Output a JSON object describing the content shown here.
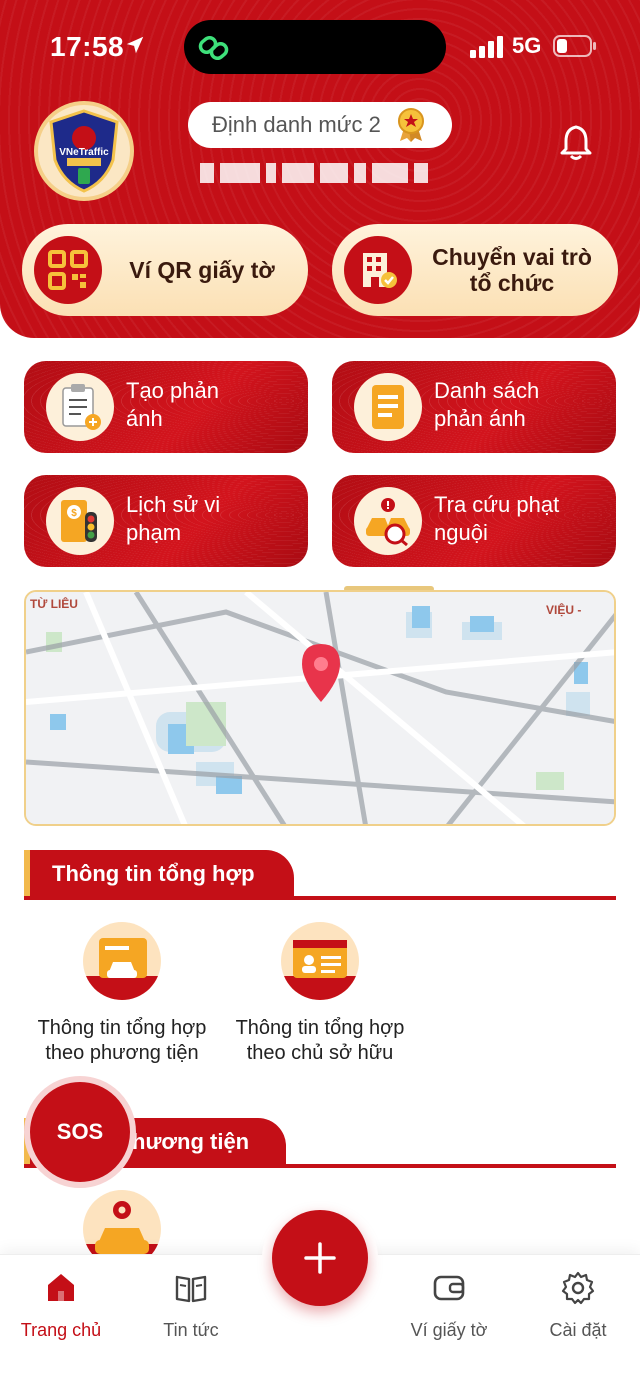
{
  "status_bar": {
    "time": "17:58",
    "network": "5G"
  },
  "header": {
    "logo_text": "VNeTraffic",
    "identity_level": "Định danh mức 2",
    "quick_actions": [
      {
        "label": "Ví QR giấy tờ",
        "icon": "qr-icon"
      },
      {
        "label": "Chuyển vai trò tổ chức",
        "icon": "building-icon"
      }
    ]
  },
  "actions": [
    {
      "label": "Tạo phản ánh",
      "icon": "clipboard-add-icon"
    },
    {
      "label": "Danh sách phản ánh",
      "icon": "document-list-icon"
    },
    {
      "label": "Lịch sử vi phạm",
      "icon": "violation-history-icon"
    },
    {
      "label": "Tra cứu phạt nguội",
      "icon": "car-search-icon"
    }
  ],
  "map": {
    "labels": [
      "TỪ LIÊU",
      "VIỆU -"
    ]
  },
  "sections": {
    "summary": {
      "title": "Thông tin tổng hợp",
      "items": [
        {
          "label": "Thông tin tổng hợp theo phương tiện",
          "icon": "vehicle-card-icon"
        },
        {
          "label": "Thông tin tổng hợp theo chủ sở hữu",
          "icon": "owner-card-icon"
        }
      ]
    },
    "vehicle": {
      "title": "hương tiện"
    }
  },
  "sos": {
    "label": "SOS"
  },
  "bottom_nav": {
    "items": [
      {
        "label": "Trang chủ",
        "icon": "home-icon",
        "active": true
      },
      {
        "label": "Tin tức",
        "icon": "book-icon"
      },
      {
        "label": "Ví giấy tờ",
        "icon": "wallet-icon"
      },
      {
        "label": "Cài đặt",
        "icon": "gear-icon"
      }
    ],
    "fab_icon": "plus-icon"
  },
  "colors": {
    "primary": "#c40f17",
    "accent": "#f2b94c",
    "cream": "#fbe0b4"
  }
}
